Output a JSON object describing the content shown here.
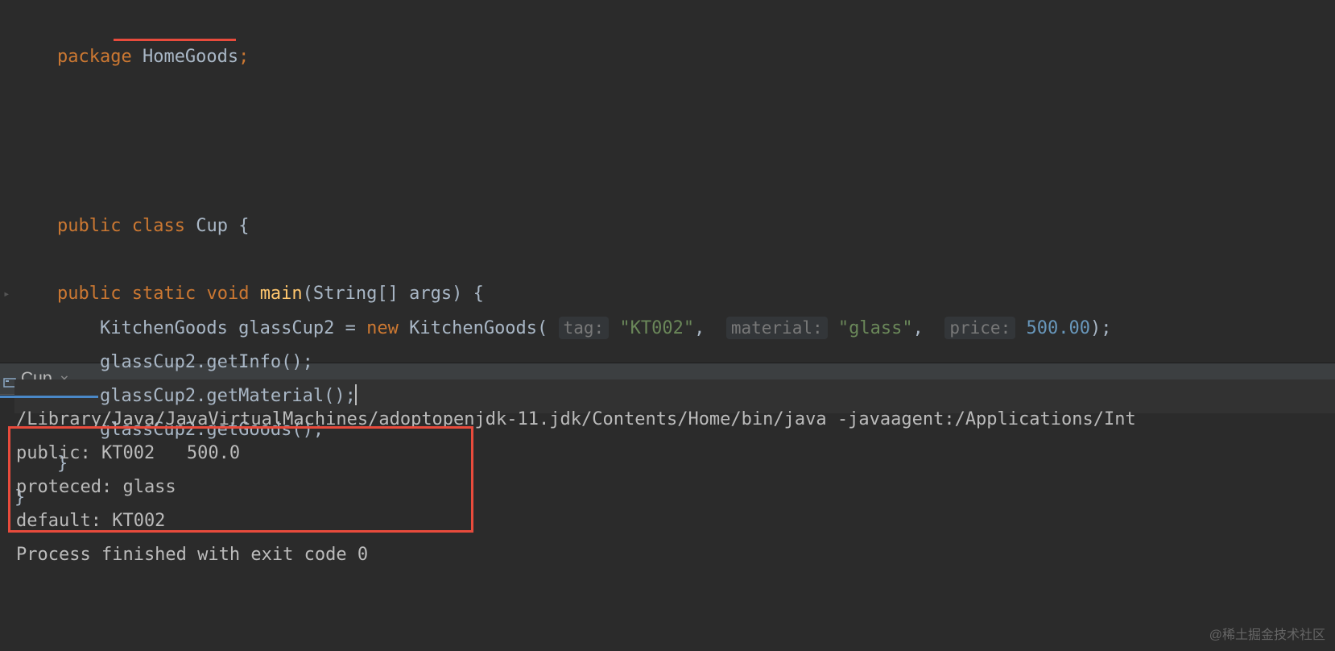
{
  "editor": {
    "lines": {
      "l1_package": "package",
      "l1_pkgname": "HomeGoods",
      "l1_semi": ";",
      "l3_public": "public",
      "l3_class": "class",
      "l3_name": "Cup",
      "l3_brace": " {",
      "l4_indent": "    ",
      "l4_public": "public",
      "l4_static": "static",
      "l4_void": "void",
      "l4_main": "main",
      "l4_params": "(String[] args) {",
      "l5_indent": "        ",
      "l5_type": "KitchenGoods glassCup2 = ",
      "l5_new": "new",
      "l5_ctor": " KitchenGoods( ",
      "l5_hint1": "tag:",
      "l5_str1": "\"KT002\"",
      "l5_comma1": ",  ",
      "l5_hint2": "material:",
      "l5_str2": "\"glass\"",
      "l5_comma2": ",  ",
      "l5_hint3": "price:",
      "l5_num": "500.00",
      "l5_end": ");",
      "l6": "        glassCup2.getInfo();",
      "l7": "        glassCup2.getMaterial();",
      "l8": "        glassCup2.getGoods();",
      "l9": "    }",
      "l10": "}"
    }
  },
  "runTab": {
    "label": "Cup",
    "close": "×"
  },
  "console": {
    "cmd": "/Library/Java/JavaVirtualMachines/adoptopenjdk-11.jdk/Contents/Home/bin/java -javaagent:/Applications/Int",
    "out1": "public: KT002   500.0",
    "out2": "proteced: glass",
    "out3": "default: KT002",
    "blank": "",
    "exit": "Process finished with exit code 0"
  },
  "watermark": "@稀土掘金技术社区"
}
